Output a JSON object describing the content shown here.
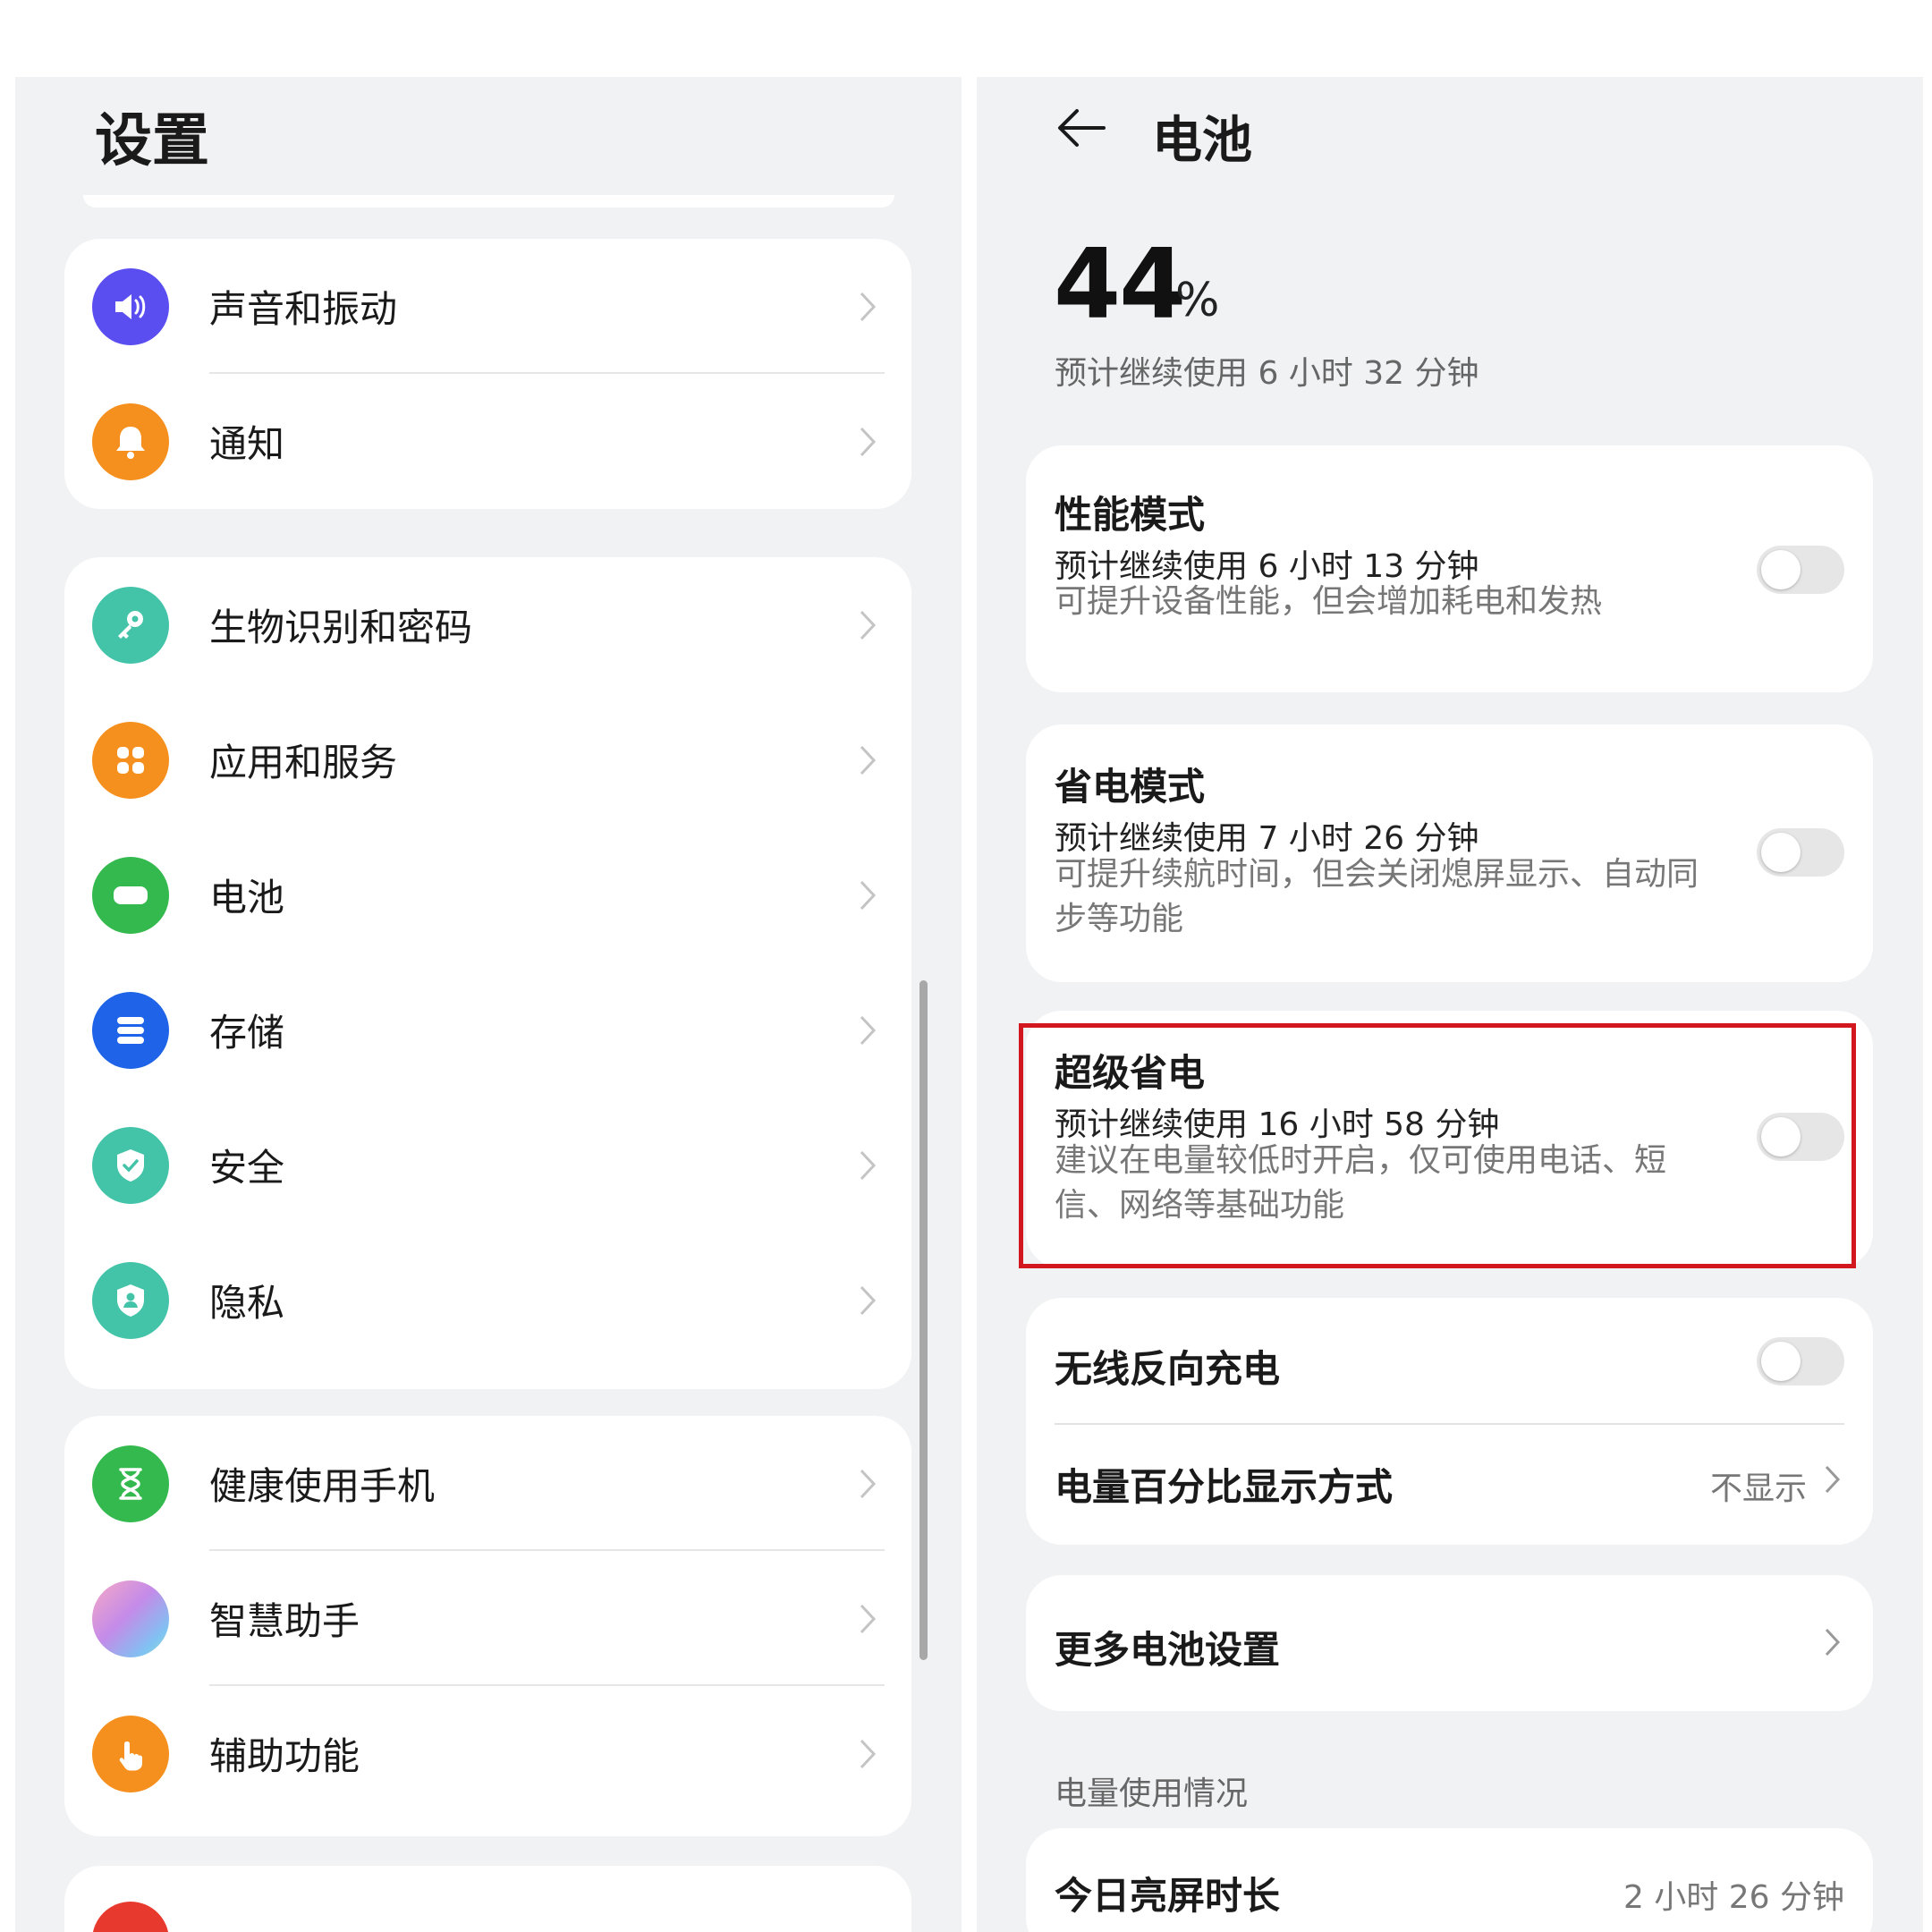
{
  "settings": {
    "title": "设置",
    "groups": [
      [
        {
          "label": "声音和振动",
          "icon": "speaker-icon",
          "color": "#5b4ef0"
        },
        {
          "label": "通知",
          "icon": "bell-icon",
          "color": "#f5901e"
        }
      ],
      [
        {
          "label": "生物识别和密码",
          "icon": "key-icon",
          "color": "#43c4a8"
        },
        {
          "label": "应用和服务",
          "icon": "apps-icon",
          "color": "#f5901e"
        },
        {
          "label": "电池",
          "icon": "battery-icon",
          "color": "#34b94e"
        },
        {
          "label": "存储",
          "icon": "storage-icon",
          "color": "#1f63e8"
        },
        {
          "label": "安全",
          "icon": "shield-check-icon",
          "color": "#43c4a8"
        },
        {
          "label": "隐私",
          "icon": "shield-person-icon",
          "color": "#43c4a8"
        }
      ],
      [
        {
          "label": "健康使用手机",
          "icon": "hourglass-icon",
          "color": "#34b94e"
        },
        {
          "label": "智慧助手",
          "icon": "assistant-icon",
          "color": "#c48be8"
        },
        {
          "label": "辅助功能",
          "icon": "hand-icon",
          "color": "#f5901e"
        }
      ]
    ]
  },
  "battery": {
    "title": "电池",
    "percent": "44",
    "percent_unit": "%",
    "remaining": "预计继续使用 6 小时 32 分钟",
    "performance_mode": {
      "title": "性能模式",
      "estimate": "预计继续使用 6 小时 13 分钟",
      "desc": "可提升设备性能，但会增加耗电和发热"
    },
    "power_saving": {
      "title": "省电模式",
      "estimate": "预计继续使用 7 小时 26 分钟",
      "desc": "可提升续航时间，但会关闭熄屏显示、自动同步等功能"
    },
    "ultra_saving": {
      "title": "超级省电",
      "estimate": "预计继续使用 16 小时 58 分钟",
      "desc": "建议在电量较低时开启，仅可使用电话、短信、网络等基础功能"
    },
    "reverse_charging": "无线反向充电",
    "percentage_display": {
      "label": "电量百分比显示方式",
      "value": "不显示"
    },
    "more_settings": "更多电池设置",
    "usage_section": "电量使用情况",
    "screen_time": {
      "label": "今日亮屏时长",
      "value": "2 小时 26 分钟"
    }
  }
}
